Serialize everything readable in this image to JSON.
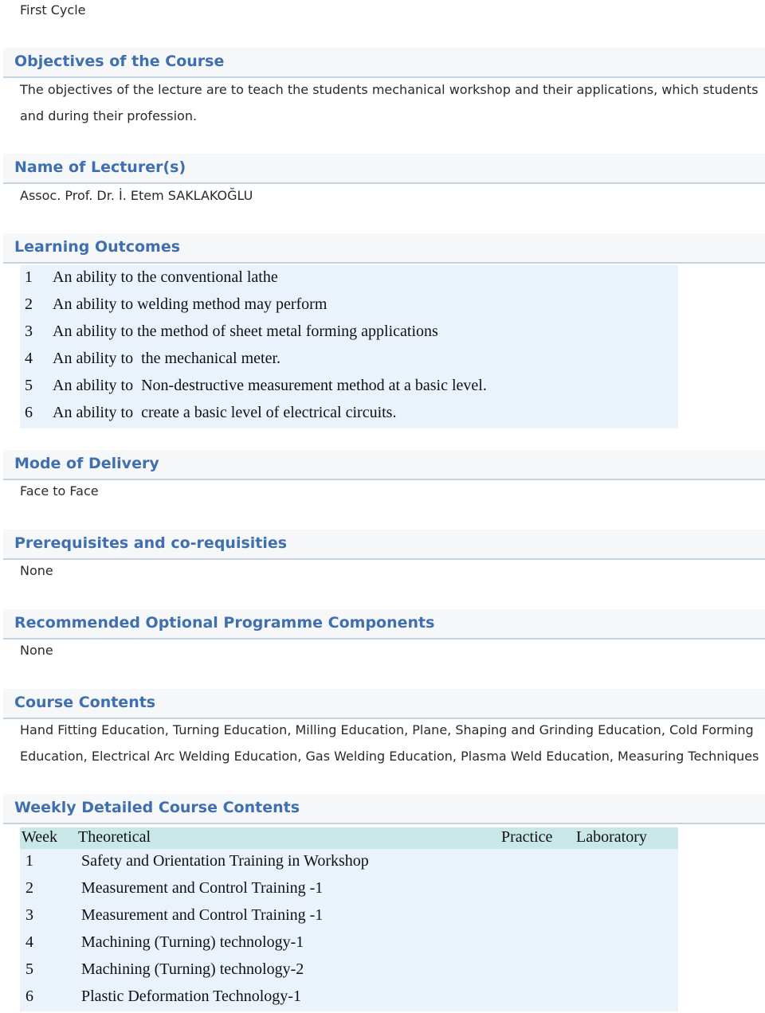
{
  "cycle": "First Cycle",
  "sections": {
    "objectives": {
      "title": "Objectives of the Course",
      "lines": [
        "The objectives of the lecture are to teach the students mechanical workshop and their applications, which students",
        "and during their profession."
      ]
    },
    "lecturers": {
      "title": "Name of Lecturer(s)",
      "value": "Assoc. Prof. Dr. İ. Etem SAKLAKOĞLU"
    },
    "learning_outcomes": {
      "title": "Learning Outcomes",
      "items": [
        {
          "num": "1",
          "text": "An ability to the conventional lathe"
        },
        {
          "num": "2",
          "text": "An ability to welding method may perform"
        },
        {
          "num": "3",
          "text": "An ability to the method of sheet metal forming applications"
        },
        {
          "num": "4",
          "text": "An ability to  the mechanical meter."
        },
        {
          "num": "5",
          "text": "An ability to  Non-destructive measurement method at a basic level."
        },
        {
          "num": "6",
          "text": "An ability to  create a basic level of electrical circuits."
        }
      ]
    },
    "mode_of_delivery": {
      "title": "Mode of Delivery",
      "value": "Face to Face"
    },
    "prerequisites": {
      "title": "Prerequisites and co-requisities",
      "value": "None"
    },
    "recommended": {
      "title": "Recommended Optional Programme Components",
      "value": "None"
    },
    "course_contents": {
      "title": "Course Contents",
      "lines": [
        "Hand Fitting Education, Turning Education, Milling Education, Plane, Shaping and Grinding Education, Cold Forming",
        "Education, Electrical Arc Welding Education, Gas Welding Education, Plasma Weld Education, Measuring Techniques"
      ]
    },
    "weekly": {
      "title": "Weekly Detailed Course Contents",
      "columns": {
        "week": "Week",
        "theoretical": "Theoretical",
        "practice": "Practice",
        "laboratory": "Laboratory"
      },
      "rows": [
        {
          "week": "1",
          "theoretical": "Safety and Orientation Training in Workshop",
          "practice": "",
          "laboratory": ""
        },
        {
          "week": "2",
          "theoretical": "Measurement and Control Training -1",
          "practice": "",
          "laboratory": ""
        },
        {
          "week": "3",
          "theoretical": "Measurement and Control Training -1",
          "practice": "",
          "laboratory": ""
        },
        {
          "week": "4",
          "theoretical": "Machining (Turning) technology-1",
          "practice": "",
          "laboratory": ""
        },
        {
          "week": "5",
          "theoretical": "Machining (Turning) technology-2",
          "practice": "",
          "laboratory": ""
        },
        {
          "week": "6",
          "theoretical": "Plastic Deformation Technology-1",
          "practice": "",
          "laboratory": ""
        }
      ]
    }
  },
  "colors": {
    "heading_text": "#3f6fae",
    "heading_bg": "#f6f7f9",
    "heading_rule": "#c5d2e0",
    "table_body_bg": "#eaf2fb",
    "table_header_bg": "#c9e7e7"
  }
}
